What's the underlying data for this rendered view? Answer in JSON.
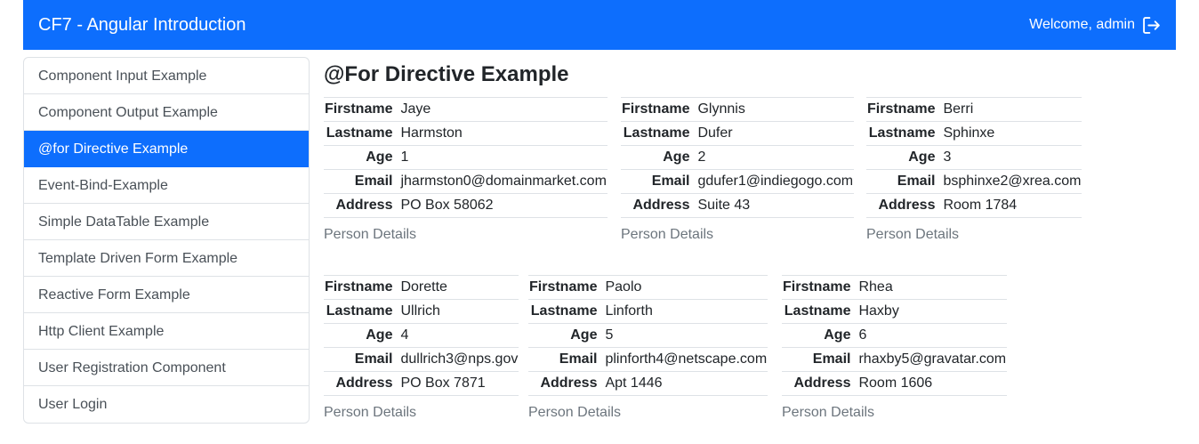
{
  "header": {
    "brand": "CF7 - Angular Introduction",
    "welcome": "Welcome, admin",
    "logout_icon": "logout-icon"
  },
  "sidebar": {
    "items": [
      {
        "label": "Component Input Example"
      },
      {
        "label": "Component Output Example"
      },
      {
        "label": "@for Directive Example",
        "active": true
      },
      {
        "label": "Event-Bind-Example"
      },
      {
        "label": "Simple DataTable Example"
      },
      {
        "label": "Template Driven Form Example"
      },
      {
        "label": "Reactive Form Example"
      },
      {
        "label": "Http Client Example"
      },
      {
        "label": "User Registration Component"
      },
      {
        "label": "User Login"
      }
    ]
  },
  "main": {
    "title": "@For Directive Example",
    "field_labels": {
      "firstname": "Firstname",
      "lastname": "Lastname",
      "age": "Age",
      "email": "Email",
      "address": "Address"
    },
    "details_label": "Person Details",
    "people": [
      {
        "firstname": "Jaye",
        "lastname": "Harmston",
        "age": "1",
        "email": "jharmston0@domainmarket.com",
        "address": "PO Box 58062"
      },
      {
        "firstname": "Glynnis",
        "lastname": "Dufer",
        "age": "2",
        "email": "gdufer1@indiegogo.com",
        "address": "Suite 43"
      },
      {
        "firstname": "Berri",
        "lastname": "Sphinxe",
        "age": "3",
        "email": "bsphinxe2@xrea.com",
        "address": "Room 1784"
      },
      {
        "firstname": "Dorette",
        "lastname": "Ullrich",
        "age": "4",
        "email": "dullrich3@nps.gov",
        "address": "PO Box 7871"
      },
      {
        "firstname": "Paolo",
        "lastname": "Linforth",
        "age": "5",
        "email": "plinforth4@netscape.com",
        "address": "Apt 1446"
      },
      {
        "firstname": "Rhea",
        "lastname": "Haxby",
        "age": "6",
        "email": "rhaxby5@gravatar.com",
        "address": "Room 1606"
      }
    ]
  },
  "colors": {
    "primary": "#0d6efd",
    "border": "#dee2e6",
    "muted": "#6c757d"
  }
}
